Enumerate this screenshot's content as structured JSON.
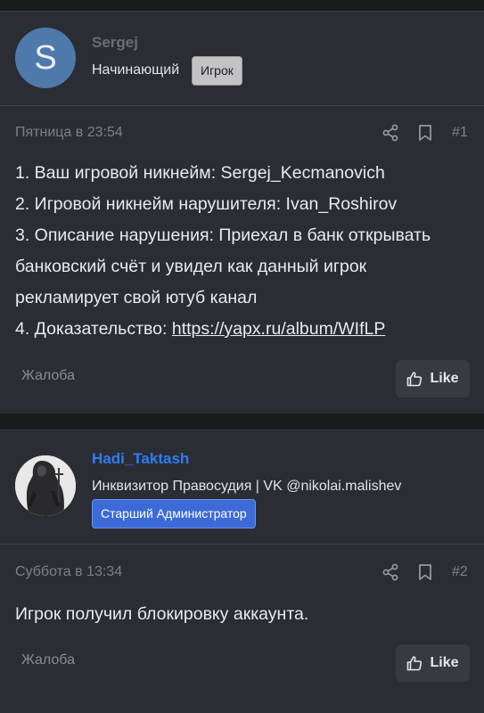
{
  "posts": [
    {
      "avatar_letter": "S",
      "username": "Sergej",
      "user_title": "Начинающий",
      "badge": "Игрок",
      "date": "Пятница в 23:54",
      "post_number": "#1",
      "content_lines": [
        "1. Ваш игровой никнейм: Sergej_Kecmanovich",
        "2. Игровой никнейм нарушителя: Ivan_Roshirov",
        "3. Описание нарушения: Приехал в банк открывать",
        "банковский счёт и увидел как данный игрок",
        "рекламирует свой ютуб канал"
      ],
      "evidence_label": "4. Доказательство: ",
      "evidence_link": "https://yapx.ru/album/WIfLP",
      "report_label": "Жалоба",
      "like_label": "Like"
    },
    {
      "username": "Hadi_Taktash",
      "user_title": "Инквизитор Правосудия | VK @nikolai.malishev",
      "badge": "Старший Администратор",
      "date": "Суббота в 13:34",
      "post_number": "#2",
      "content": "Игрок получил блокировку аккаунта.",
      "report_label": "Жалоба",
      "like_label": "Like"
    }
  ],
  "icons": {
    "share": "share-icon",
    "bookmark": "bookmark-icon",
    "like": "thumbs-up-icon"
  },
  "colors": {
    "background": "#1b1c20",
    "card": "#2b2d34",
    "admin_name": "#2f7cf6",
    "admin_badge": "#3c6bd8",
    "player_badge": "#c3c3c5",
    "avatar_s": "#4f79ab"
  }
}
